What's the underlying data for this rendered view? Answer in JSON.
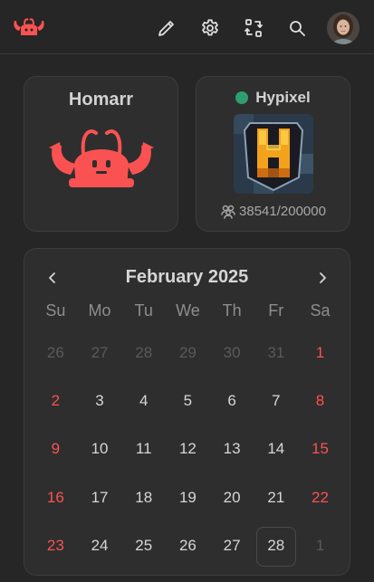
{
  "colors": {
    "accent": "#fa5252",
    "status_online": "#2f9e6e",
    "background": "#262626",
    "card": "#2e2e2e"
  },
  "header": {
    "icons": [
      "logo-icon",
      "pencil-icon",
      "gear-icon",
      "swap-icon",
      "search-icon",
      "avatar"
    ]
  },
  "app_card": {
    "title": "Homarr"
  },
  "minecraft_card": {
    "name": "Hypixel",
    "status": "online",
    "players": "38541/200000"
  },
  "calendar": {
    "title": "February 2025",
    "weekdays": [
      "Su",
      "Mo",
      "Tu",
      "We",
      "Th",
      "Fr",
      "Sa"
    ],
    "weeks": [
      [
        "26",
        "27",
        "28",
        "29",
        "30",
        "31",
        "1"
      ],
      [
        "2",
        "3",
        "4",
        "5",
        "6",
        "7",
        "8"
      ],
      [
        "9",
        "10",
        "11",
        "12",
        "13",
        "14",
        "15"
      ],
      [
        "16",
        "17",
        "18",
        "19",
        "20",
        "21",
        "22"
      ],
      [
        "23",
        "24",
        "25",
        "26",
        "27",
        "28",
        "1"
      ]
    ],
    "today": "28"
  }
}
